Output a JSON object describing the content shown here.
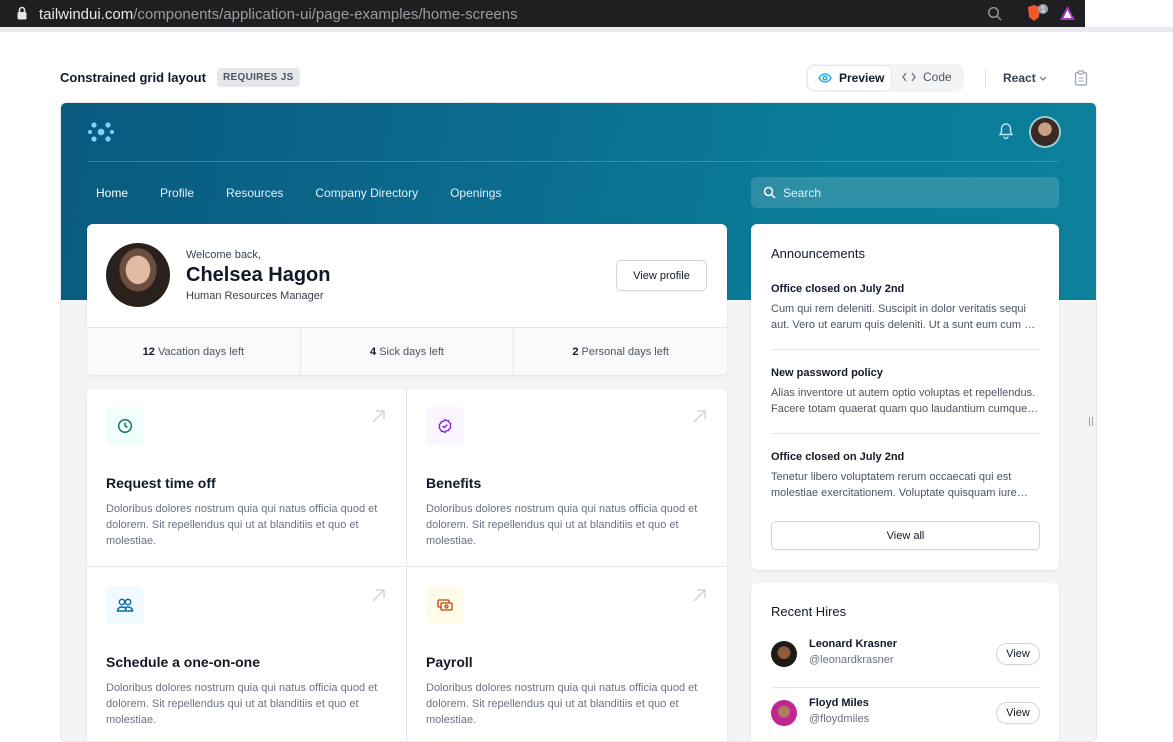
{
  "browser": {
    "host": "tailwindui.com",
    "path": "/components/application-ui/page-examples/home-screens",
    "ext_badge": "1"
  },
  "header": {
    "title": "Constrained grid layout",
    "badge": "REQUIRES JS",
    "preview": "Preview",
    "code": "Code",
    "framework": "React"
  },
  "nav": {
    "items": [
      "Home",
      "Profile",
      "Resources",
      "Company Directory",
      "Openings"
    ],
    "search_placeholder": "Search"
  },
  "profile": {
    "welcome": "Welcome back,",
    "name": "Chelsea Hagon",
    "role": "Human Resources Manager",
    "view_profile": "View profile",
    "stats": [
      {
        "value": "12",
        "label": "Vacation days left"
      },
      {
        "value": "4",
        "label": "Sick days left"
      },
      {
        "value": "2",
        "label": "Personal days left"
      }
    ]
  },
  "actions": [
    {
      "title": "Request time off",
      "desc": "Doloribus dolores nostrum quia qui natus officia quod et dolorem. Sit repellendus qui ut at blanditiis et quo et molestiae.",
      "icon": "clock-icon",
      "bg": "#f0fdfa",
      "fg": "#0f766e"
    },
    {
      "title": "Benefits",
      "desc": "Doloribus dolores nostrum quia qui natus officia quod et dolorem. Sit repellendus qui ut at blanditiis et quo et molestiae.",
      "icon": "badge-check-icon",
      "bg": "#faf5ff",
      "fg": "#7e22ce"
    },
    {
      "title": "Schedule a one-on-one",
      "desc": "Doloribus dolores nostrum quia qui natus officia quod et dolorem. Sit repellendus qui ut at blanditiis et quo et molestiae.",
      "icon": "users-icon",
      "bg": "#f0f9ff",
      "fg": "#0369a1"
    },
    {
      "title": "Payroll",
      "desc": "Doloribus dolores nostrum quia qui natus officia quod et dolorem. Sit repellendus qui ut at blanditiis et quo et molestiae.",
      "icon": "cash-icon",
      "bg": "#fefce8",
      "fg": "#a16207"
    }
  ],
  "announcements": {
    "title": "Announcements",
    "view_all": "View all",
    "items": [
      {
        "title": "Office closed on July 2nd",
        "body": "Cum qui rem deleniti. Suscipit in dolor veritatis sequi aut. Vero ut earum quis deleniti. Ut a sunt eum cum ut repudiandae possimus. Nihil ex tempora neque cum consectetur dolores."
      },
      {
        "title": "New password policy",
        "body": "Alias inventore ut autem optio voluptas et repellendus. Facere totam quaerat quam quo laudantium cumque eaque excepturi vel."
      },
      {
        "title": "Office closed on July 2nd",
        "body": "Tenetur libero voluptatem rerum occaecati qui est molestiae exercitationem. Voluptate quisquam iure assumenda consequatur ex et recusandae."
      }
    ]
  },
  "hires": {
    "title": "Recent Hires",
    "view": "View",
    "people": [
      {
        "name": "Leonard Krasner",
        "handle": "@leonardkrasner"
      },
      {
        "name": "Floyd Miles",
        "handle": "@floydmiles"
      }
    ]
  }
}
